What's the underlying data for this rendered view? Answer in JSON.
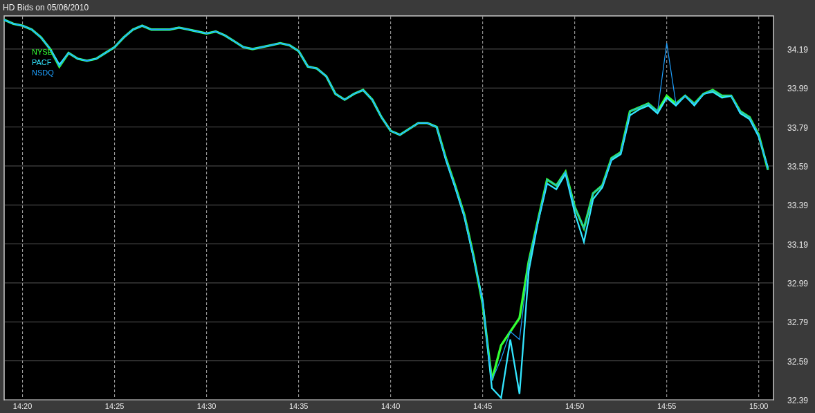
{
  "chart_data": {
    "type": "line",
    "title": "HD Bids on 05/06/2010",
    "categories": [
      null,
      null,
      "14:20",
      null,
      null,
      null,
      null,
      null,
      null,
      null,
      null,
      null,
      "14:25",
      null,
      null,
      null,
      null,
      null,
      null,
      null,
      null,
      null,
      "14:30",
      null,
      null,
      null,
      null,
      null,
      null,
      null,
      null,
      null,
      "14:35",
      null,
      null,
      null,
      null,
      null,
      null,
      null,
      null,
      null,
      "14:40",
      null,
      null,
      null,
      null,
      null,
      null,
      null,
      null,
      null,
      "14:45",
      null,
      null,
      null,
      null,
      null,
      null,
      null,
      null,
      null,
      "14:50",
      null,
      null,
      null,
      null,
      null,
      null,
      null,
      null,
      null,
      "14:55",
      null,
      null,
      null,
      null,
      null,
      null,
      null,
      null,
      null,
      "15:00",
      null
    ],
    "series": [
      {
        "name": "NYSE",
        "color": "#33ff33",
        "values": [
          34.34,
          34.32,
          34.31,
          34.29,
          34.25,
          34.19,
          34.1,
          34.17,
          34.14,
          34.13,
          34.14,
          34.17,
          34.2,
          34.25,
          34.29,
          34.31,
          34.29,
          34.29,
          34.29,
          34.3,
          34.29,
          34.28,
          34.27,
          34.28,
          34.26,
          34.23,
          34.2,
          34.19,
          34.2,
          34.21,
          34.22,
          34.21,
          34.18,
          34.1,
          34.09,
          34.05,
          33.96,
          33.93,
          33.96,
          33.98,
          33.93,
          33.84,
          33.77,
          33.75,
          33.78,
          33.81,
          33.81,
          33.79,
          33.63,
          33.49,
          33.34,
          33.13,
          32.88,
          32.49,
          32.67,
          32.74,
          32.81,
          33.1,
          33.31,
          33.52,
          33.49,
          33.56,
          33.38,
          33.27,
          33.45,
          33.49,
          33.63,
          33.66,
          33.87,
          33.89,
          33.91,
          33.87,
          33.95,
          33.91,
          33.95,
          33.91,
          33.96,
          33.98,
          33.95,
          33.95,
          33.87,
          33.84,
          33.75,
          33.57
        ]
      },
      {
        "name": "PACF",
        "color": "#33e6ff",
        "values": [
          34.34,
          34.32,
          34.31,
          34.29,
          34.25,
          34.19,
          34.11,
          34.17,
          34.14,
          34.13,
          34.14,
          34.17,
          34.2,
          34.25,
          34.29,
          34.31,
          34.29,
          34.29,
          34.29,
          34.3,
          34.29,
          34.28,
          34.27,
          34.28,
          34.26,
          34.23,
          34.2,
          34.19,
          34.2,
          34.21,
          34.22,
          34.21,
          34.18,
          34.1,
          34.09,
          34.05,
          33.96,
          33.93,
          33.96,
          33.98,
          33.93,
          33.84,
          33.77,
          33.75,
          33.78,
          33.81,
          33.81,
          33.79,
          33.62,
          33.48,
          33.33,
          33.12,
          32.9,
          32.45,
          32.4,
          32.7,
          32.42,
          33.05,
          33.3,
          33.5,
          33.47,
          33.55,
          33.35,
          33.2,
          33.42,
          33.48,
          33.62,
          33.65,
          33.85,
          33.88,
          33.9,
          33.86,
          33.94,
          33.9,
          33.95,
          33.9,
          33.96,
          33.97,
          33.94,
          33.95,
          33.86,
          33.83,
          33.74,
          33.58
        ]
      },
      {
        "name": "NSDQ",
        "color": "#1ea0ff",
        "values": [
          34.34,
          34.32,
          34.31,
          34.29,
          34.25,
          34.19,
          34.1,
          34.17,
          34.14,
          34.13,
          34.14,
          34.17,
          34.2,
          34.25,
          34.29,
          34.31,
          34.29,
          34.29,
          34.29,
          34.3,
          34.29,
          34.28,
          34.27,
          34.28,
          34.26,
          34.23,
          34.2,
          34.19,
          34.2,
          34.21,
          34.22,
          34.21,
          34.18,
          34.1,
          34.09,
          34.05,
          33.96,
          33.93,
          33.96,
          33.98,
          33.93,
          33.84,
          33.77,
          33.75,
          33.78,
          33.81,
          33.81,
          33.79,
          33.63,
          33.49,
          33.34,
          33.13,
          32.88,
          32.49,
          32.6,
          32.74,
          32.7,
          33.1,
          33.31,
          33.52,
          33.49,
          33.56,
          33.38,
          33.27,
          33.45,
          33.49,
          33.63,
          33.66,
          33.87,
          33.89,
          33.91,
          33.87,
          34.22,
          33.91,
          33.95,
          33.91,
          33.96,
          33.98,
          33.95,
          33.95,
          33.87,
          33.84,
          33.75,
          33.57
        ]
      }
    ],
    "ylim": [
      32.39,
      34.36
    ],
    "grid": true,
    "yticks": [
      {
        "value": 34.19,
        "label": "34.19"
      },
      {
        "value": 33.99,
        "label": "33.99"
      },
      {
        "value": 33.79,
        "label": "33.79"
      },
      {
        "value": 33.59,
        "label": "33.59"
      },
      {
        "value": 33.39,
        "label": "33.39"
      },
      {
        "value": 33.19,
        "label": "33.19"
      },
      {
        "value": 32.99,
        "label": "32.99"
      },
      {
        "value": 32.79,
        "label": "32.79"
      },
      {
        "value": 32.59,
        "label": "32.59"
      },
      {
        "value": 32.39,
        "label": "32.39"
      }
    ]
  }
}
